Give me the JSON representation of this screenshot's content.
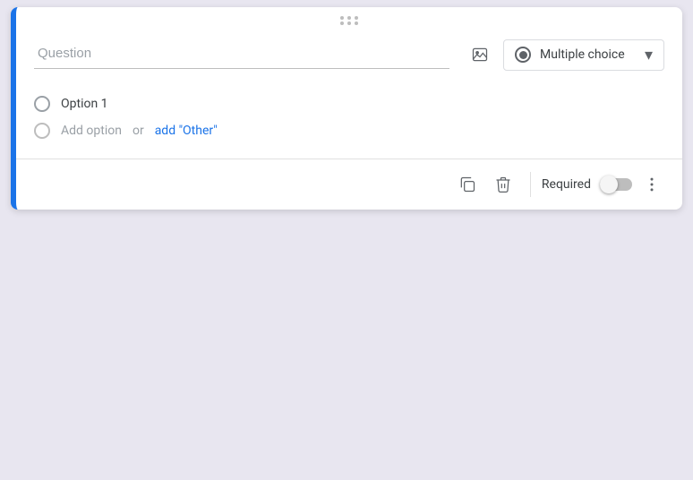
{
  "card": {
    "drag_handle_dots": "⠿",
    "question_placeholder": "Question",
    "type_label": "Multiple choice",
    "option1_label": "Option 1",
    "add_option_text": "Add option",
    "or_text": "or",
    "add_other_text": "add \"Other\"",
    "required_label": "Required",
    "copy_icon": "copy-icon",
    "delete_icon": "delete-icon",
    "more_icon": "more-icon",
    "image_icon": "image-icon"
  },
  "colors": {
    "accent": "#1a73e8",
    "border_left": "#1a73e8"
  }
}
